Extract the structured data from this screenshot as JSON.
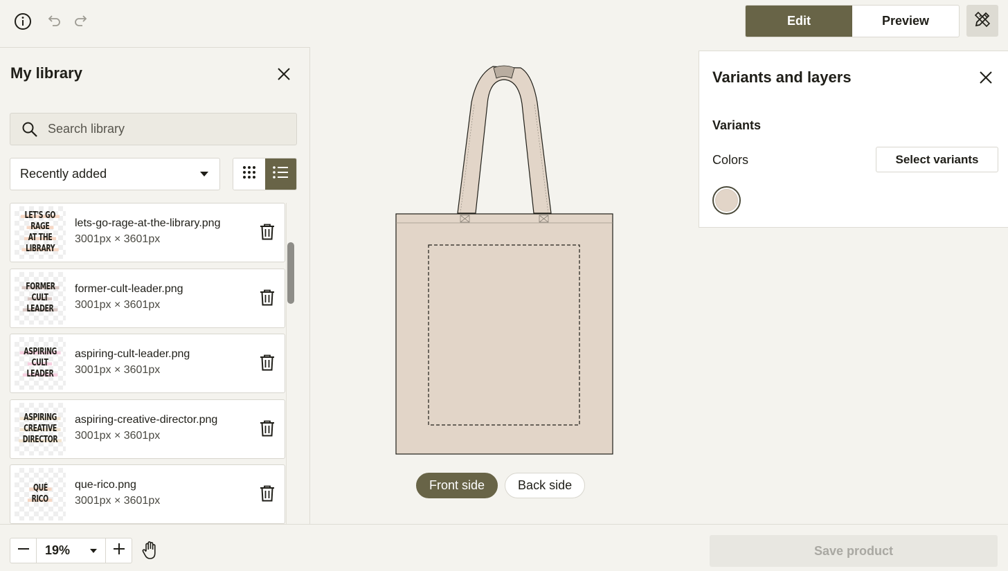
{
  "header": {
    "mode_edit_label": "Edit",
    "mode_preview_label": "Preview",
    "active_mode": "Edit"
  },
  "library": {
    "title": "My library",
    "search_placeholder": "Search library",
    "sort_value": "Recently added",
    "active_view": "list",
    "items": [
      {
        "name": "lets-go-rage-at-the-library.png",
        "dims": "3001px × 3601px",
        "thumb_lines": [
          "LET'S GO",
          "RAGE",
          "AT THE",
          "LIBRARY"
        ],
        "thumb_highlight": "#f6d7c4"
      },
      {
        "name": "former-cult-leader.png",
        "dims": "3001px × 3601px",
        "thumb_lines": [
          "FORMER",
          "CULT",
          "LEADER"
        ],
        "thumb_highlight": "#d8c7c3"
      },
      {
        "name": "aspiring-cult-leader.png",
        "dims": "3001px × 3601px",
        "thumb_lines": [
          "ASPIRING",
          "CULT",
          "LEADER"
        ],
        "thumb_highlight": "#f7cfe0"
      },
      {
        "name": "aspiring-creative-director.png",
        "dims": "3001px × 3601px",
        "thumb_lines": [
          "ASPIRING",
          "CREATIVE",
          "DIRECTOR"
        ],
        "thumb_highlight": "#f3e5d0"
      },
      {
        "name": "que-rico.png",
        "dims": "3001px × 3601px",
        "thumb_lines": [
          "QUÉ",
          "RICO"
        ],
        "thumb_highlight": "#f6d7c4"
      }
    ]
  },
  "canvas": {
    "product_color": "#e2d5c8",
    "sides": [
      "Front side",
      "Back side"
    ],
    "active_side": "Front side"
  },
  "variants_panel": {
    "title": "Variants and layers",
    "section_label": "Variants",
    "colors_label": "Colors",
    "select_button": "Select variants",
    "selected_color": "#e2d5c8"
  },
  "footer": {
    "zoom_value": "19%",
    "save_label": "Save product"
  },
  "colors": {
    "accent": "#686447",
    "background": "#f4f3ee"
  }
}
